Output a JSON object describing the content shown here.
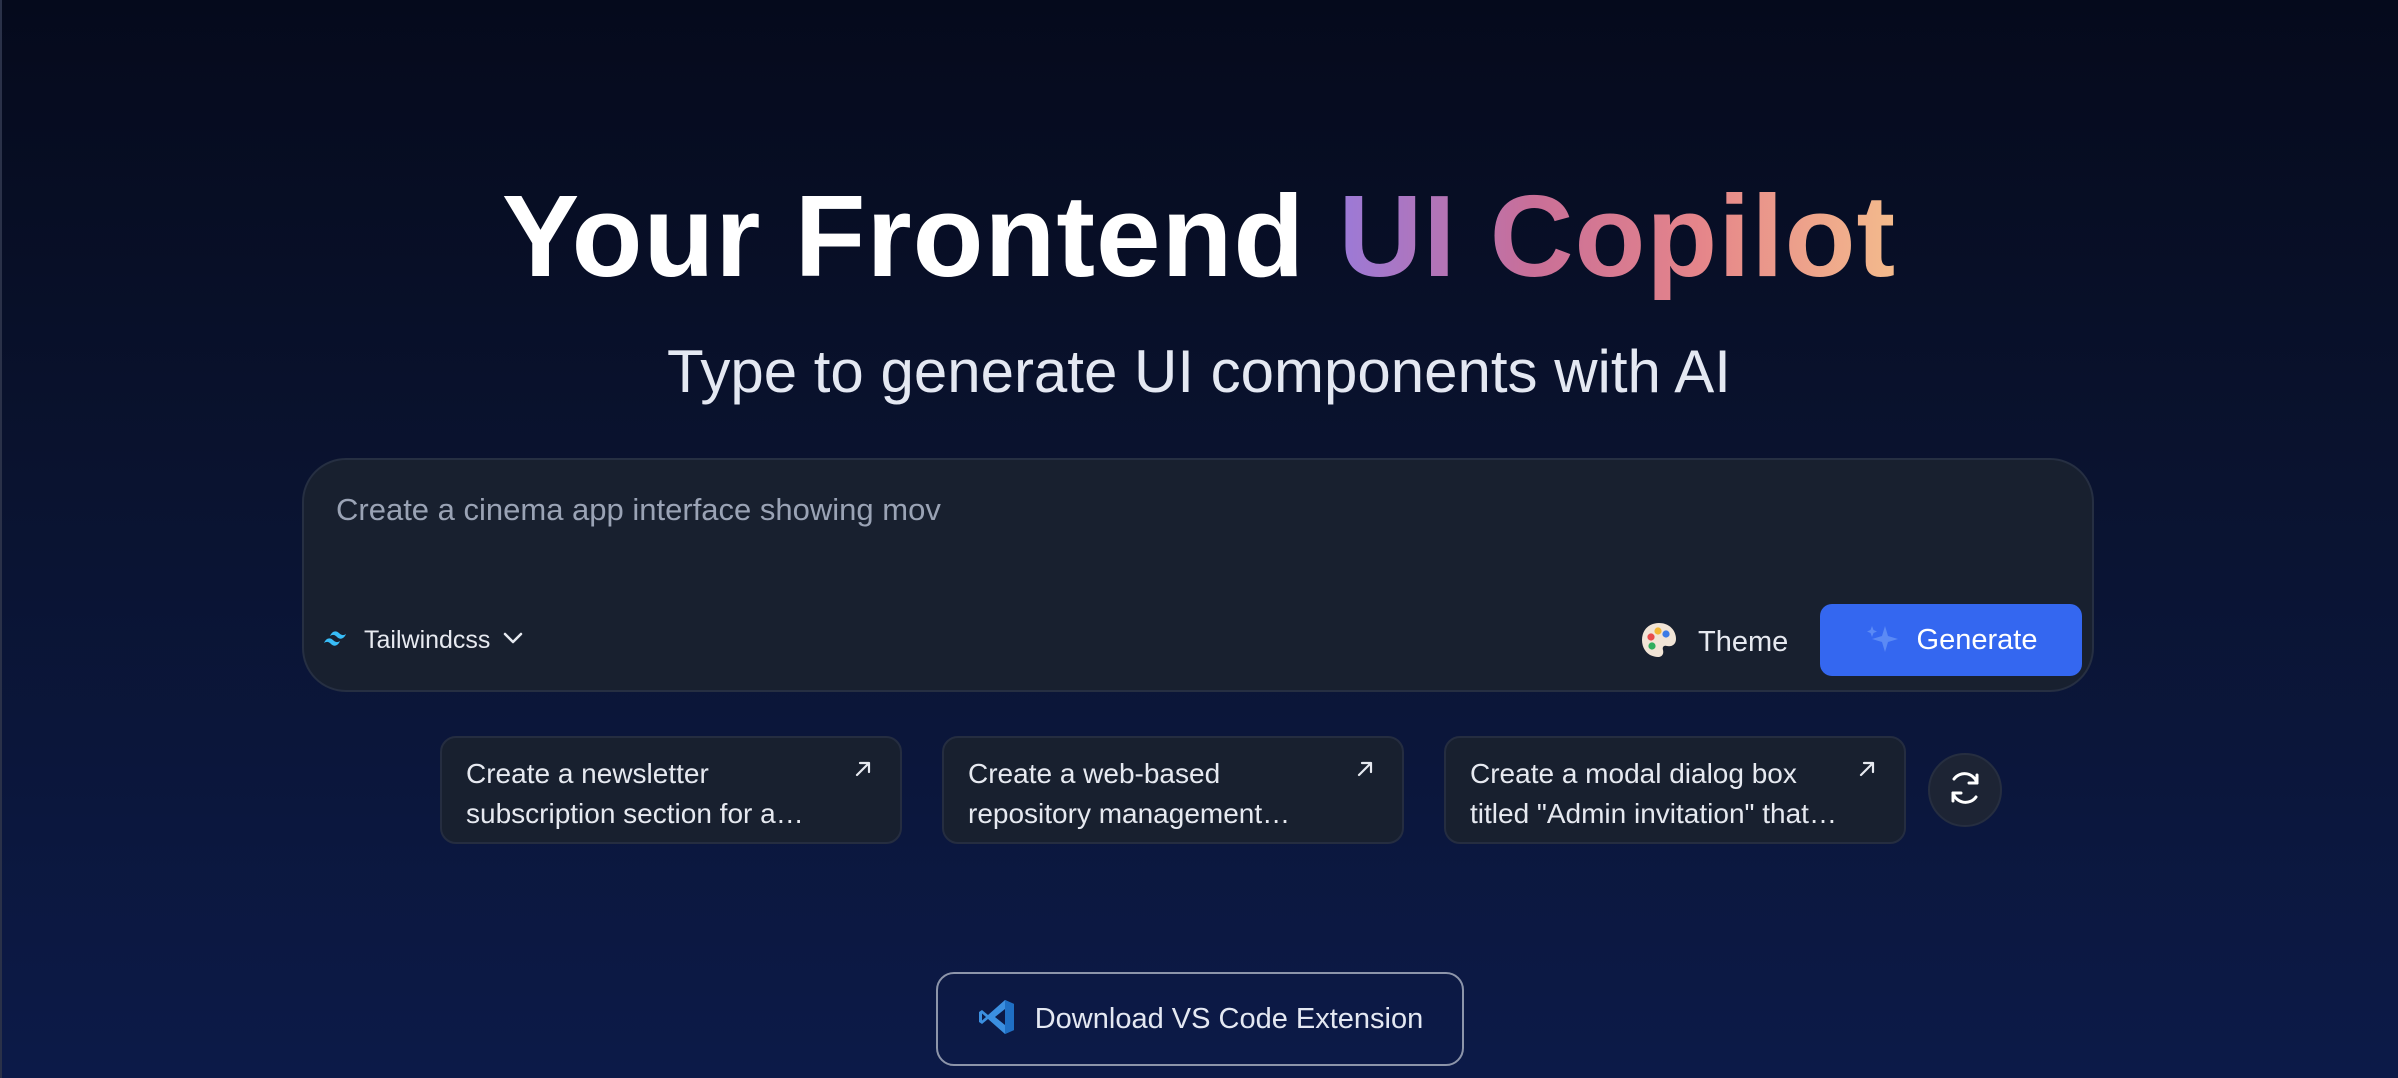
{
  "hero": {
    "title_plain": "Your Frontend ",
    "title_accent": "UI Copilot",
    "subtitle": "Type to generate UI components with AI"
  },
  "prompt": {
    "value": "Create a cinema app interface showing mov",
    "framework": "Tailwindcss",
    "theme_label": "Theme",
    "generate_label": "Generate"
  },
  "suggestions": [
    {
      "text": "Create a newsletter subscription section for a…"
    },
    {
      "text": "Create a web-based repository management…"
    },
    {
      "text": "Create a modal dialog box titled \"Admin invitation\" that…"
    }
  ],
  "download": {
    "label": "Download VS Code Extension"
  },
  "icons": {
    "framework": "tailwind-icon",
    "dropdown": "chevron-down-icon",
    "theme": "palette-icon",
    "generate": "sparkle-icon",
    "suggestion": "arrow-up-right-icon",
    "refresh": "refresh-icon",
    "download": "vscode-icon"
  },
  "colors": {
    "accent_gradient": [
      "#9b7ad8",
      "#c96f98",
      "#e5858a",
      "#f4bb8c"
    ],
    "primary_button": "#3467f0",
    "background_top": "#050a1c",
    "background_bottom": "#0c1a48"
  }
}
